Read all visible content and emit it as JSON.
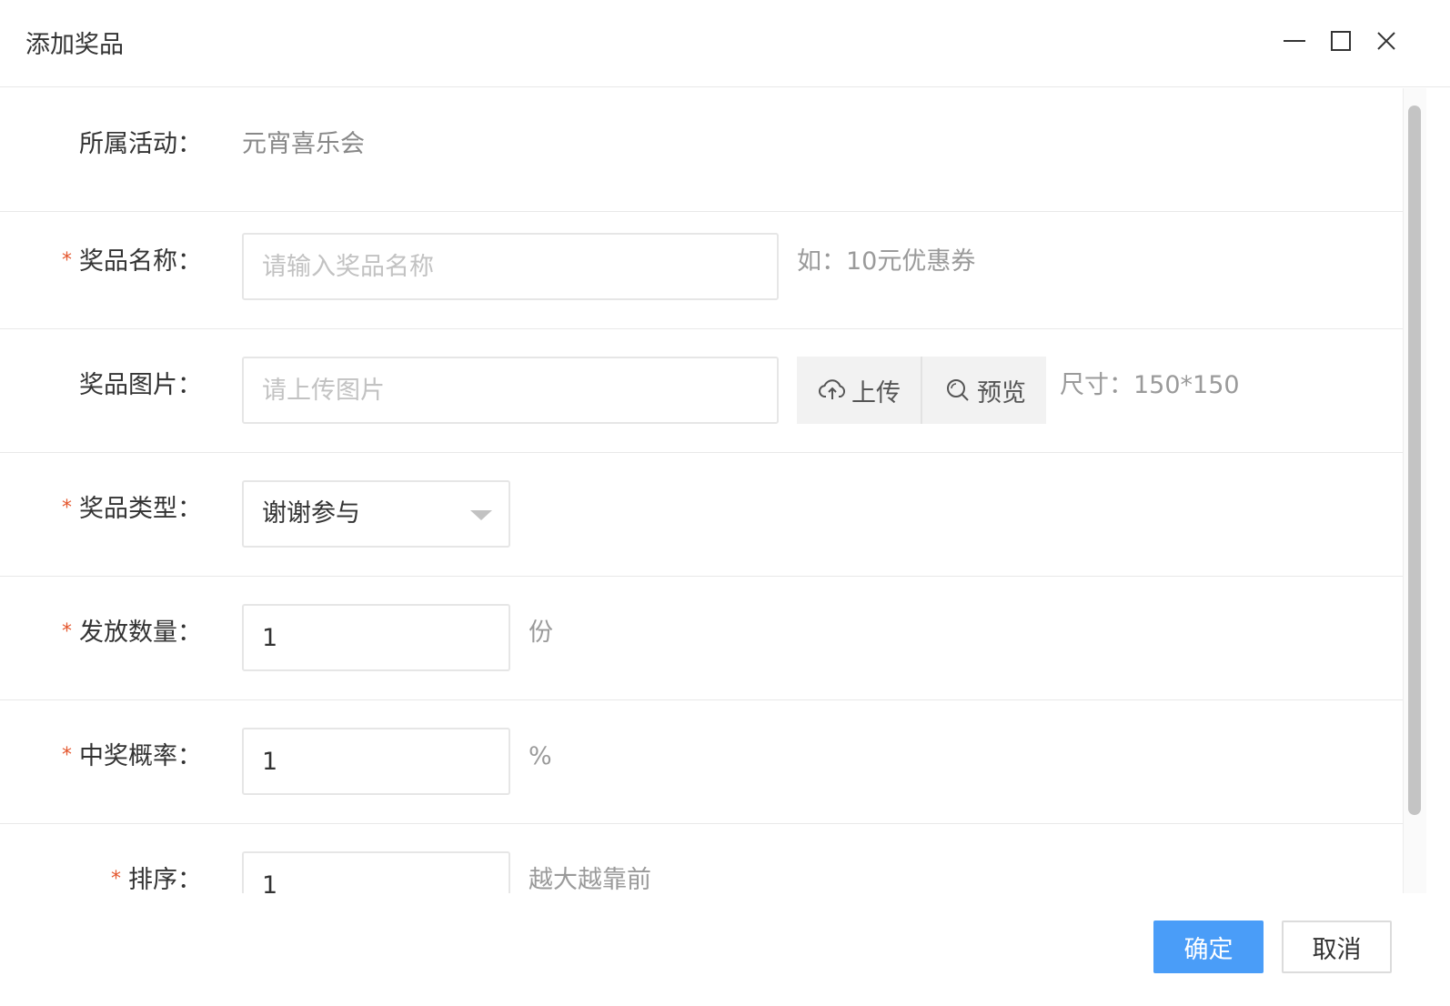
{
  "dialog": {
    "title": "添加奖品",
    "window_controls": [
      "minimize-icon",
      "maximize-icon",
      "close-icon"
    ]
  },
  "form": {
    "activity": {
      "label": "所属活动：",
      "value": "元宵喜乐会"
    },
    "prize_name": {
      "required_mark": "*",
      "label": "奖品名称：",
      "placeholder": "请输入奖品名称",
      "hint": "如：10元优惠券"
    },
    "prize_image": {
      "label": "奖品图片：",
      "placeholder": "请上传图片",
      "upload_label": "上传",
      "upload_icon": "cloud-upload-icon",
      "preview_label": "预览",
      "preview_icon": "magnifier-icon",
      "hint": "尺寸：150*150"
    },
    "prize_type": {
      "required_mark": "*",
      "label": "奖品类型：",
      "selected": "谢谢参与"
    },
    "quantity": {
      "required_mark": "*",
      "label": "发放数量：",
      "value": "1",
      "unit": "份"
    },
    "probability": {
      "required_mark": "*",
      "label": "中奖概率：",
      "value": "1",
      "unit": "%"
    },
    "sort": {
      "required_mark": "*",
      "label": "排序：",
      "value": "1",
      "hint": "越大越靠前"
    }
  },
  "footer": {
    "confirm_label": "确定",
    "cancel_label": "取消"
  },
  "colors": {
    "primary": "#4a9df8",
    "required": "#e4572e",
    "hint": "#9a9a9a"
  }
}
